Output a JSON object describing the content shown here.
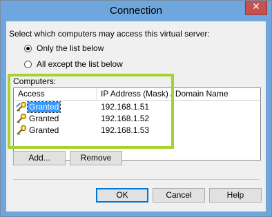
{
  "window": {
    "title": "Connection",
    "close_glyph": "✕",
    "titlebar_color": "#6ea6dd",
    "close_color": "#c75050"
  },
  "content": {
    "prompt": "Select which computers may access this virtual server:",
    "radio_only": {
      "label": "Only the list below",
      "checked": true
    },
    "radio_except": {
      "label": "All except the list below",
      "checked": false
    },
    "computers_label": "Computers:"
  },
  "list": {
    "columns": [
      "Access",
      "IP Address (Mask) / Domain Name"
    ],
    "rows": [
      {
        "access": "Granted",
        "ip": "192.168.1.51",
        "icon": "key-icon",
        "selected": true
      },
      {
        "access": "Granted",
        "ip": "192.168.1.52",
        "icon": "key-icon",
        "selected": false
      },
      {
        "access": "Granted",
        "ip": "192.168.1.53",
        "icon": "key-icon",
        "selected": false
      }
    ]
  },
  "buttons": {
    "add": "Add...",
    "remove": "Remove",
    "ok": "OK",
    "cancel": "Cancel",
    "help": "Help"
  },
  "annotation": {
    "highlight_color": "#a6d22b"
  }
}
